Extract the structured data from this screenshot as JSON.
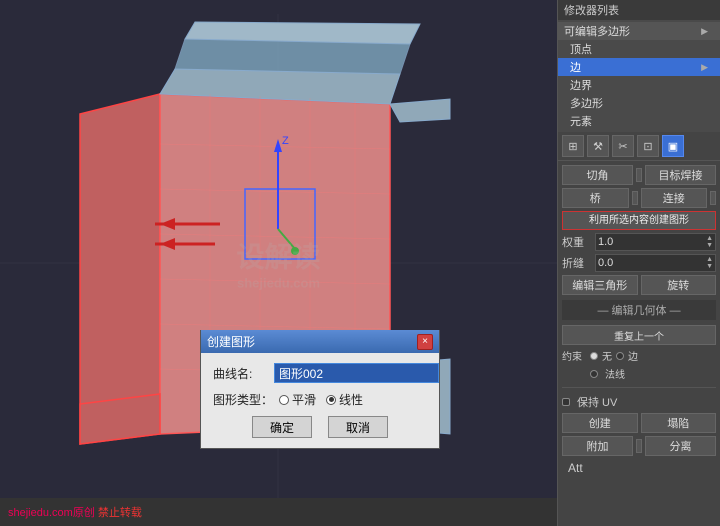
{
  "viewport": {
    "watermark": "设解读",
    "watermark_url": "shejiedu.com",
    "watermark2": "设解读",
    "watermark2_url": "shejiedu.com"
  },
  "bottom_bar": {
    "prefix": "shejiedu.com原创 ",
    "highlight": "禁止转载"
  },
  "dialog": {
    "title": "创建图形",
    "close_btn": "×",
    "curve_name_label": "曲线名:",
    "curve_name_value": "图形002",
    "shape_type_label": "图形类型：",
    "radio_smooth": "平滑",
    "radio_linear": "线性",
    "confirm_btn": "确定",
    "cancel_btn": "取消"
  },
  "right_panel": {
    "modifier_list_label": "修改器列表",
    "editable_poly_label": "可编辑多边形",
    "items": [
      {
        "label": "顶点",
        "active": false
      },
      {
        "label": "边",
        "active": true,
        "has_arrow": true
      },
      {
        "label": "边界",
        "active": false
      },
      {
        "label": "多边形",
        "active": false
      },
      {
        "label": "元素",
        "active": false
      }
    ],
    "toolbar_icons": [
      "⊞",
      "⚙",
      "✂",
      "⊡",
      "▣"
    ],
    "buttons": {
      "chamfer": "切角",
      "target_weld": "目标焊接",
      "bridge": "桥",
      "connect": "连接",
      "create_shape": "利用所选内容创建图形",
      "weight_label": "权重",
      "weight_value": "1.0",
      "crease_label": "折缝",
      "crease_value": "0.0",
      "edit_triangles": "编辑三角形",
      "rotate": "旋转",
      "edit_geometry_label": "编辑几何体",
      "repeat_last": "重复上一个",
      "constraint_label": "约束",
      "constraint_none": "无",
      "constraint_edge": "边",
      "constraint_face": "法线",
      "preserve_uv": "保持 UV",
      "create": "创建",
      "collapse": "塌陷",
      "attach": "附加",
      "detach": "分离",
      "att_text": "Att"
    }
  }
}
